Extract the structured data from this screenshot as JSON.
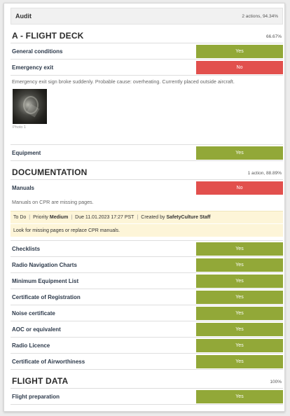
{
  "audit": {
    "title": "Audit",
    "score": "2 actions, 94.34%"
  },
  "sections": [
    {
      "name": "A - FLIGHT DECK",
      "score": "66.67%"
    },
    {
      "name": "DOCUMENTATION",
      "score": "1 action, 88.89%"
    },
    {
      "name": "FLIGHT DATA",
      "score": "100%"
    }
  ],
  "flight_deck": {
    "general_conditions": {
      "q": "General conditions",
      "a": "Yes"
    },
    "emergency_exit": {
      "q": "Emergency exit",
      "a": "No"
    },
    "emergency_note": "Emergency exit sign broke suddenly. Probable cause: overheating. Currently placed outside aircraft.",
    "photo_caption": "Photo 1",
    "equipment": {
      "q": "Equipment",
      "a": "Yes"
    }
  },
  "documentation": {
    "manuals": {
      "q": "Manuals",
      "a": "No"
    },
    "manuals_note": "Manuals on CPR are missing pages.",
    "action": {
      "status": "To Do",
      "priority_label": "Priority",
      "priority": "Medium",
      "due": "Due 11.01.2023 17:27 PST",
      "created_by_label": "Created by",
      "created_by": "SafetyCulture Staff",
      "description": "Look for missing pages or replace CPR manuals."
    },
    "items": [
      {
        "q": "Checklists",
        "a": "Yes"
      },
      {
        "q": "Radio Navigation Charts",
        "a": "Yes"
      },
      {
        "q": "Minimum Equipment List",
        "a": "Yes"
      },
      {
        "q": "Certificate of Registration",
        "a": "Yes"
      },
      {
        "q": "Noise certificate",
        "a": "Yes"
      },
      {
        "q": "AOC or equivalent",
        "a": "Yes"
      },
      {
        "q": "Radio Licence",
        "a": "Yes"
      },
      {
        "q": "Certificate of Airworthiness",
        "a": "Yes"
      }
    ]
  },
  "flight_data": {
    "flight_preparation": {
      "q": "Flight preparation",
      "a": "Yes"
    }
  },
  "colors": {
    "yes": "#92a838",
    "no": "#e2504d",
    "action_bg": "#fdf5d8"
  }
}
